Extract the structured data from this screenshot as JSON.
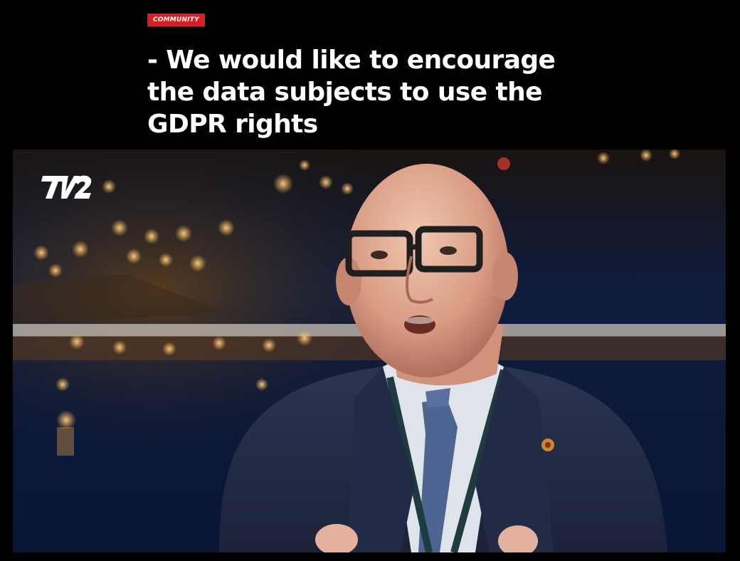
{
  "article": {
    "category": "COMMUNITY",
    "headline": "- We would like to encourage the data subjects to use the GDPR rights"
  },
  "video": {
    "channel_logo": "TV 2",
    "colors": {
      "badge": "#d81f26",
      "background": "#000000"
    }
  }
}
